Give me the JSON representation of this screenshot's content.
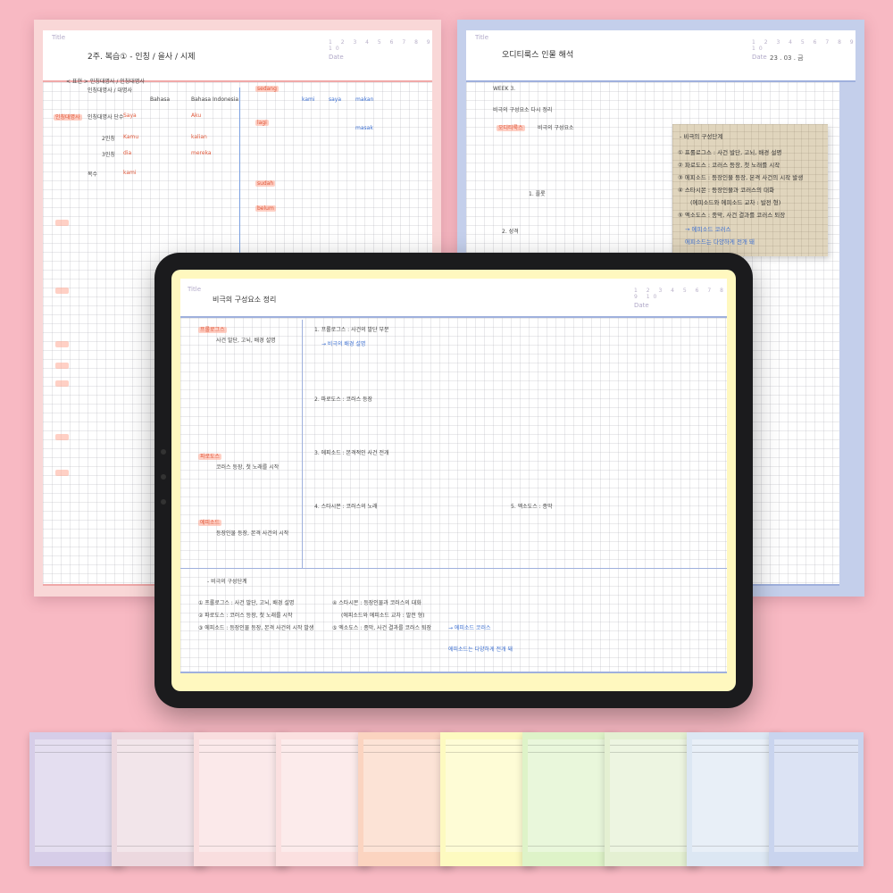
{
  "sheets": {
    "left": {
      "label": "Title",
      "title": "2주. 복습① - 인칭 / 을사 / 시제",
      "date_label": "Date",
      "page_numbers": "1 2 3 4 5 6 7 8 9 10",
      "accent": "#f4a8a8",
      "notes": [
        "< 표현 > 인칭대명사 / 인칭대명사",
        "인칭대명사 / 대명사",
        "인칭대명사",
        "인칭대명사 단수",
        "2인칭",
        "3인칭",
        "복수",
        "Bahasa",
        "Bahasa Indonesia",
        "Kamu",
        "dia",
        "kami",
        "Saya",
        "Aku",
        "kalian",
        "mereka",
        "sedang",
        "lagi",
        "sudah",
        "belum",
        "kami",
        "saya",
        "makan",
        "masak"
      ]
    },
    "right": {
      "label": "Title",
      "title": "오디티룩스 인물 해석",
      "date_label": "Date",
      "date_value": "23 . 03 . 금",
      "page_numbers": "1 2 3 4 5 6 7 8 9 10",
      "accent": "#c4cfeb",
      "notes": [
        "WEEK 3.",
        "비극의 구성요소 다시 정리",
        "오디티룩스",
        "비극의 구성요소",
        "1. 플롯",
        "2. 성격"
      ]
    }
  },
  "sticky": {
    "heading": "- 비극의 구성단계",
    "items": [
      "① 프롤로그스 : 사건 발단, 고뇌, 배경 설명",
      "② 파로도스 : 코러스 등장, 첫 노래를 시작",
      "③ 에피소드 : 등장인물 등장, 본격 사건의 시작 발생",
      "④ 스타시몬 : 등장인물과 코러스의 대화",
      "(에피소드와 에피소드 교차 : 발전 형)",
      "⑤ 엑소도스 : 종막, 사건 결과를 코러스 퇴장",
      "→ 에피소드 코러스",
      "에피소드는 다양하게 전개 돼"
    ]
  },
  "tablet": {
    "label": "Title",
    "title": "비극의 구성요소 정리",
    "date_label": "Date",
    "page_numbers": "1 2 3 4 5 6 7 8 9 10",
    "left_tags": [
      "프롤로그스",
      "파로도스",
      "에피소드"
    ],
    "left_notes": [
      "사건 발단, 고뇌, 배경 설명",
      "코러스 등장, 첫 노래를 시작",
      "등장인물 등장, 본격 사건의 시작"
    ],
    "body_lines": [
      "1. 프롤로그스 : 사건의 발단 부분",
      "→ 비극의 배경 설명",
      "2. 파로도스 : 코러스 등장",
      "3. 에피소드 : 본격적인 사건 전개",
      "4. 스타시몬 : 코러스의 노래",
      "5. 엑소도스 : 종막"
    ],
    "bottom_heading": "- 비극의 구성단계",
    "bottom_items": [
      "① 프롤로그스 : 사건 발단, 고뇌, 배경 설명",
      "② 파로도스 : 코러스 등장, 첫 노래를 시작",
      "③ 에피소드 : 등장인물 등장, 본격 사건의 시작 발생",
      "④ 스타시몬 : 등장인물과 코러스의 대화",
      "(에피소드와 에피소드 교차 : 발전 형)",
      "⑤ 엑소도스 : 종막, 사건 결과를 코러스 퇴장",
      "→ 에피소드 코러스",
      "에피소드는 다양하게 전개 돼"
    ]
  },
  "swatches": [
    {
      "color": "#d6cde8",
      "name": "lavender"
    },
    {
      "color": "#ecd8df",
      "name": "dusty-pink"
    },
    {
      "color": "#f9dedf",
      "name": "light-pink"
    },
    {
      "color": "#fbe0e0",
      "name": "blush"
    },
    {
      "color": "#fbd4c0",
      "name": "peach"
    },
    {
      "color": "#fdfac0",
      "name": "lemon"
    },
    {
      "color": "#def3c8",
      "name": "light-green"
    },
    {
      "color": "#e4f0d2",
      "name": "mint"
    },
    {
      "color": "#dce7f3",
      "name": "light-blue"
    },
    {
      "color": "#c9d4ee",
      "name": "periwinkle"
    }
  ]
}
